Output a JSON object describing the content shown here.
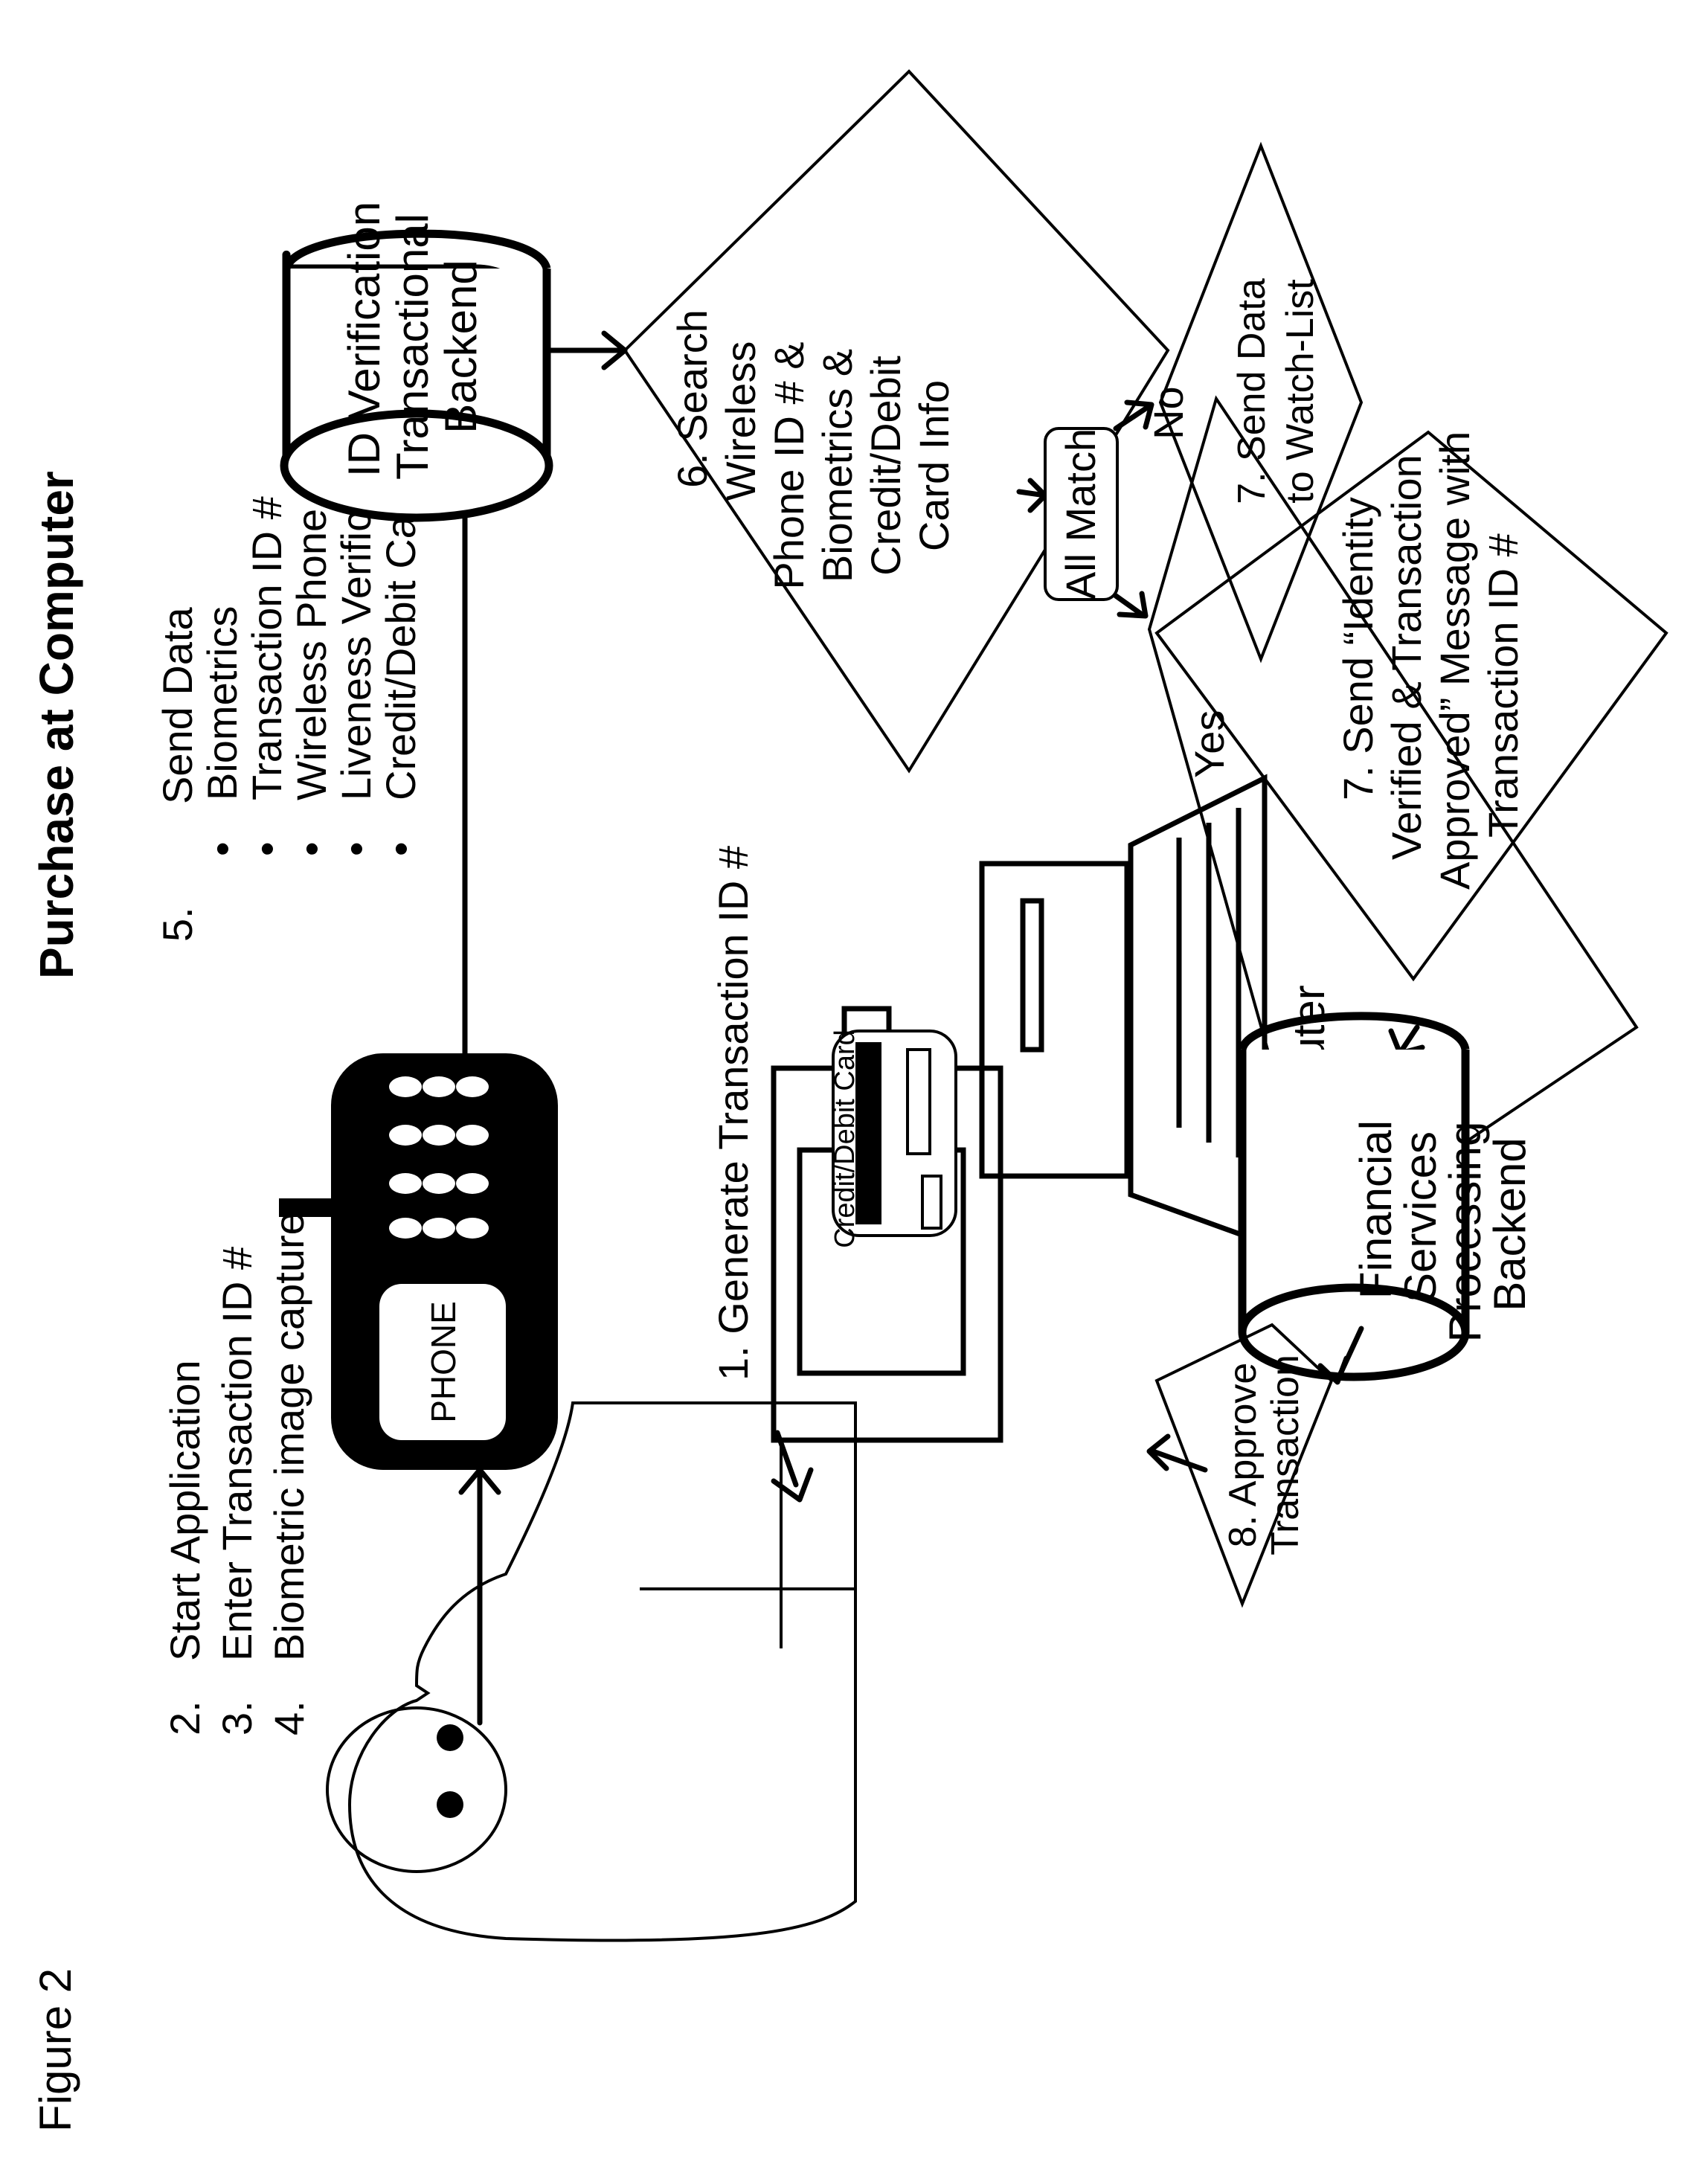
{
  "figure": {
    "label": "Figure 2",
    "title": "Purchase at Computer"
  },
  "user_steps": [
    {
      "num": "2.",
      "text": "Start Application"
    },
    {
      "num": "3.",
      "text": "Enter Transaction ID #"
    },
    {
      "num": "4.",
      "text": "Biometric image capture"
    }
  ],
  "send_data": {
    "num": "5.",
    "heading": "Send Data",
    "bullet": "•",
    "items": [
      "Biometrics",
      "Transaction ID #",
      "Wireless Phone ID #",
      "Liveness Verification",
      "Credit/Debit Card Info"
    ]
  },
  "phone": {
    "label": "PHONE"
  },
  "card": {
    "label": "Credit/Debit Card"
  },
  "computer": {
    "label": "Computer",
    "step1": "1. Generate Transaction ID #"
  },
  "id_backend": {
    "lines": [
      "ID Verification",
      "Transactional",
      "Backend"
    ]
  },
  "search_step": {
    "lines": [
      "6. Search",
      "Wireless",
      "Phone ID # &",
      "Biometrics &",
      "Credit/Debit",
      "Card Info"
    ]
  },
  "match_box": {
    "label": "All Match"
  },
  "branch_labels": {
    "no": "No",
    "yes": "Yes"
  },
  "watchlist_step": {
    "lines": [
      "7. Send Data",
      "to Watch-List"
    ]
  },
  "approved_step": {
    "lines": [
      "7. Send “Identity",
      "Verified & Transaction",
      "Approved” Message with",
      "Transaction ID #"
    ]
  },
  "fin_backend": {
    "lines": [
      "Financial",
      "Services",
      "Processing",
      "Backend"
    ]
  },
  "approve_step": {
    "lines": [
      "8. Approve",
      "Transaction"
    ]
  }
}
